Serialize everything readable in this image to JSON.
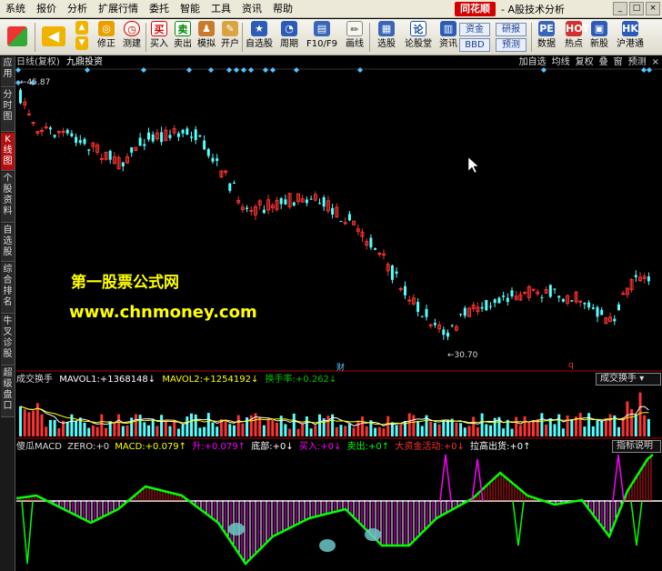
{
  "menu": [
    "系统",
    "报价",
    "分析",
    "扩展行情",
    "委托",
    "智能",
    "工具",
    "资讯",
    "帮助"
  ],
  "brand": {
    "logo": "同花顺",
    "subtitle": "- A股技术分析"
  },
  "window_controls": [
    "_",
    "□",
    "×"
  ],
  "toolbar": {
    "items": [
      "修正",
      "测建",
      "买入",
      "卖出",
      "模拟",
      "开户",
      "自选股",
      "周期",
      "F10/F9",
      "画线",
      "选股",
      "论股堂",
      "资讯",
      "数据",
      "热点",
      "新股",
      "沪港通"
    ],
    "small_buttons": [
      "资金",
      "研报",
      "BBD",
      "预测"
    ]
  },
  "side_tabs": [
    "应用",
    "分时图",
    "K线图",
    "个股资料",
    "自选股",
    "综合排名",
    "牛叉诊股",
    "超级盘口"
  ],
  "active_side_tab": "K线图",
  "kline": {
    "title": "日线(复权)",
    "stock": "九鼎投资",
    "actions": [
      "加自选",
      "均线",
      "复权",
      "叠",
      "窗",
      "预测"
    ],
    "high_label": "45.87",
    "low_label": "30.70",
    "marker_cai": "财",
    "marker_q": "q"
  },
  "watermark": {
    "line1": "第一股票公式网",
    "line2": "www.chnmoney.com"
  },
  "volume": {
    "name": "成交换手",
    "mavol1_label": "MAVOL1:",
    "mavol1_value": "+1368148",
    "mavol1_arrow": "↓",
    "mavol2_label": "MAVOL2:",
    "mavol2_value": "+1254192",
    "mavol2_arrow": "↓",
    "turnover_label": "换手率:",
    "turnover_value": "+0.262",
    "turnover_arrow": "↓",
    "selector": "成交换手"
  },
  "macd": {
    "name": "傻瓜MACD",
    "zero_label": "ZERO:",
    "zero_value": "+0",
    "macd_label": "MACD:",
    "macd_value": "+0.079",
    "macd_arrow": "↑",
    "rise_label": "升:",
    "rise_value": "+0.079",
    "rise_arrow": "↑",
    "bottom_label": "底部:",
    "bottom_value": "+0",
    "bottom_arrow": "↓",
    "buy_label": "买入:",
    "buy_value": "+0",
    "buy_arrow": "↓",
    "sell_label": "卖出:",
    "sell_value": "+0",
    "sell_arrow": "↑",
    "bigfund_label": "大资金活动:",
    "bigfund_value": "+0",
    "bigfund_arrow": "↓",
    "surge_label": "拉高出货:",
    "surge_value": "+0",
    "surge_arrow": "↑",
    "help": "指标说明"
  },
  "colors": {
    "up": "#ff3232",
    "down": "#54ffff",
    "mavol1": "#ffffff",
    "mavol2": "#ffff00",
    "macd_pos": "#ff00ff",
    "macd_neg": "#00ff00",
    "diamond": "#54c6ff",
    "active_tab": "#b01010",
    "watermark": "#ffff00"
  }
}
